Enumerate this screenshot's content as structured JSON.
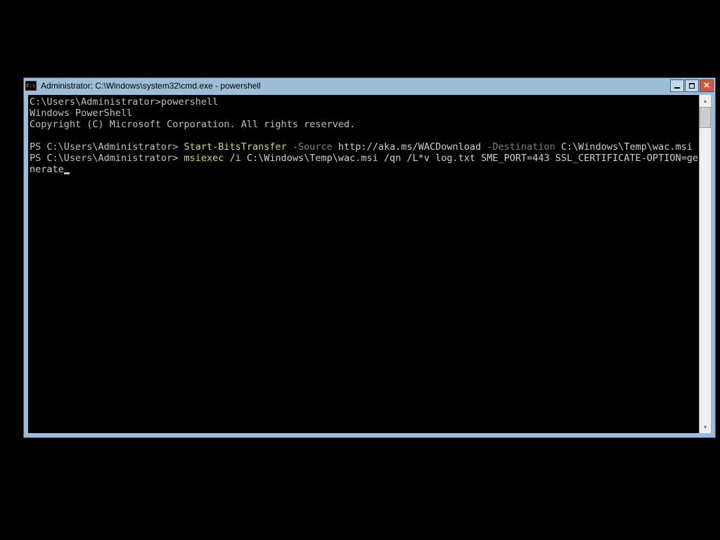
{
  "window": {
    "title": "Administrator: C:\\Windows\\system32\\cmd.exe - powershell"
  },
  "terminal": {
    "line1_prompt": "C:\\Users\\Administrator>",
    "line1_cmd": "powershell",
    "line2": "Windows PowerShell",
    "line3": "Copyright (C) Microsoft Corporation. All rights reserved.",
    "ps_prompt": "PS C:\\Users\\Administrator> ",
    "cmd1_verb": "Start-BitsTransfer",
    "cmd1_param1": " -Source ",
    "cmd1_arg1": "http://aka.ms/WACDownload",
    "cmd1_param2": " -Destination ",
    "cmd1_arg2": "C:\\Windows\\Temp\\wac.msi",
    "cmd2_verb": "msiexec",
    "cmd2_rest": " /i C:\\Windows\\Temp\\wac.msi /qn /L*v log.txt SME_PORT=443 SSL_CERTIFICATE-OPTION=generate"
  }
}
